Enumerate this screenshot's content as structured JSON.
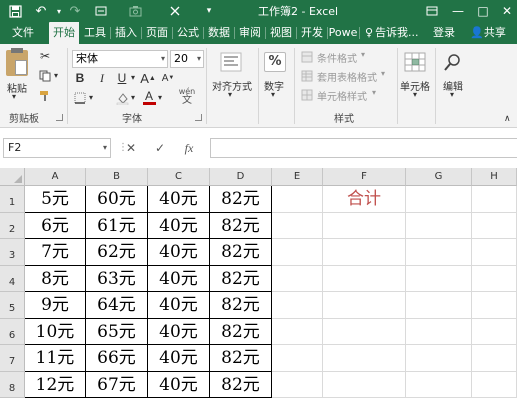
{
  "window": {
    "title": "工作簿2 - Excel",
    "minimize": "—",
    "maximize": "□",
    "close": "✕"
  },
  "quick_access": {
    "save_icon": "save-icon",
    "undo": "↶",
    "redo": "↷",
    "customize": "▾"
  },
  "tabs": [
    "文件",
    "开始",
    "工具",
    "插入",
    "页面",
    "公式",
    "数据",
    "审阅",
    "视图",
    "开发",
    "Powe"
  ],
  "tell_me": "告诉我...",
  "login": "登录",
  "share": "共享",
  "ribbon": {
    "clipboard": {
      "label": "剪贴板",
      "paste": "粘贴"
    },
    "font": {
      "label": "字体",
      "name": "宋体",
      "size": "20",
      "bold": "B",
      "italic": "I",
      "underline": "U",
      "grow": "A",
      "shrink": "A",
      "font_color": "A",
      "wen": "wén"
    },
    "alignment": {
      "label": "对齐方式"
    },
    "number": {
      "label": "数字",
      "pct": "%"
    },
    "styles": {
      "label": "样式",
      "conditional": "条件格式",
      "table": "套用表格格式",
      "cell": "单元格样式"
    },
    "cells": {
      "label": "单元格"
    },
    "editing": {
      "label": "编辑"
    }
  },
  "formula_bar": {
    "name_box": "F2",
    "cancel": "✕",
    "enter": "✓",
    "fx": "fx",
    "value": ""
  },
  "sheet": {
    "columns": [
      "A",
      "B",
      "C",
      "D",
      "E",
      "F",
      "G",
      "H"
    ],
    "rows": [
      "1",
      "2",
      "3",
      "4",
      "5",
      "6",
      "7",
      "8"
    ],
    "cells": [
      [
        "5元",
        "60元",
        "40元",
        "82元",
        "",
        "合计",
        "",
        ""
      ],
      [
        "6元",
        "61元",
        "40元",
        "82元",
        "",
        "",
        "",
        ""
      ],
      [
        "7元",
        "62元",
        "40元",
        "82元",
        "",
        "",
        "",
        ""
      ],
      [
        "8元",
        "63元",
        "40元",
        "82元",
        "",
        "",
        "",
        ""
      ],
      [
        "9元",
        "64元",
        "40元",
        "82元",
        "",
        "",
        "",
        ""
      ],
      [
        "10元",
        "65元",
        "40元",
        "82元",
        "",
        "",
        "",
        ""
      ],
      [
        "11元",
        "66元",
        "40元",
        "82元",
        "",
        "",
        "",
        ""
      ],
      [
        "12元",
        "67元",
        "40元",
        "82元",
        "",
        "",
        "",
        ""
      ]
    ]
  },
  "colors": {
    "brand": "#217346",
    "accent_red": "#c0504d"
  }
}
